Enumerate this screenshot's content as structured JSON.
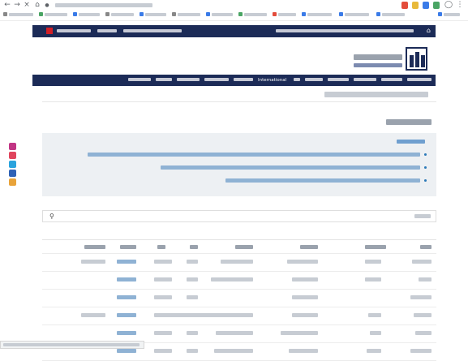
{
  "browser": {
    "url": "",
    "bookmarks": [
      "",
      "",
      "",
      "",
      "",
      "",
      "",
      "",
      "",
      "",
      "",
      "",
      ""
    ]
  },
  "topbar": {
    "left_text": "",
    "mid_text": "",
    "right_text": ""
  },
  "header": {
    "logo_fa": "",
    "logo_en": ""
  },
  "nav": {
    "items": [
      "",
      "",
      "",
      "",
      "",
      "International",
      "",
      "",
      "",
      "",
      "",
      ""
    ]
  },
  "breadcrumb": "",
  "page_title": "",
  "info": {
    "heading": "",
    "lines": [
      "",
      "",
      ""
    ]
  },
  "search": {
    "placeholder": ""
  },
  "table": {
    "headers": [
      "",
      "",
      "",
      "",
      "",
      "",
      "",
      ""
    ],
    "rows": [
      [
        "",
        "",
        "",
        "",
        "",
        "",
        "",
        ""
      ],
      [
        "",
        "",
        "",
        "",
        "",
        "",
        "",
        ""
      ],
      [
        "",
        "",
        "",
        "",
        "",
        "",
        "",
        ""
      ],
      [
        "",
        "",
        "",
        "",
        "",
        "",
        "",
        ""
      ],
      [
        "",
        "",
        "",
        "",
        "",
        "",
        "",
        ""
      ],
      [
        "",
        "",
        "",
        "",
        "",
        "",
        "",
        ""
      ]
    ]
  },
  "status_url": "",
  "colors": {
    "navy": "#1c2b57",
    "accent_red": "#d21f26",
    "link_blue": "#2b78b8",
    "info_bg": "#edf0f3"
  }
}
